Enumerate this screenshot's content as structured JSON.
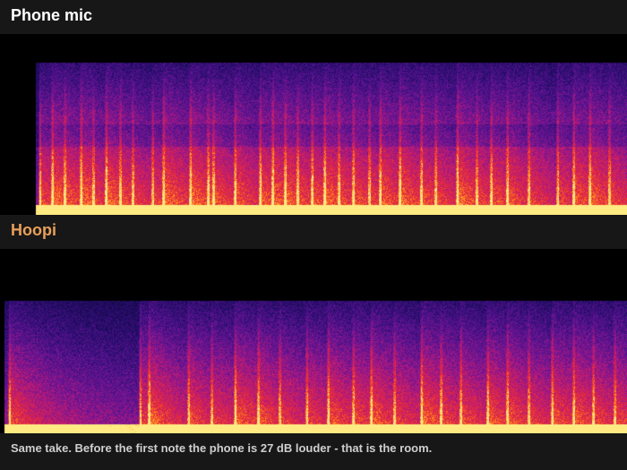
{
  "panels": [
    {
      "title": "Phone mic",
      "title_color": "#ffffff"
    },
    {
      "title": "Hoopi",
      "title_color": "#e8a05a"
    }
  ],
  "caption": "Same take. Before the first note the phone is 27 dB louder - that is the room.",
  "colors": {
    "background": "#151515",
    "spectrogram_low": "#1a0a50",
    "spectrogram_mid": "#8a1fa0",
    "spectrogram_high": "#ff3a1a",
    "spectrogram_peak": "#ffe070"
  }
}
